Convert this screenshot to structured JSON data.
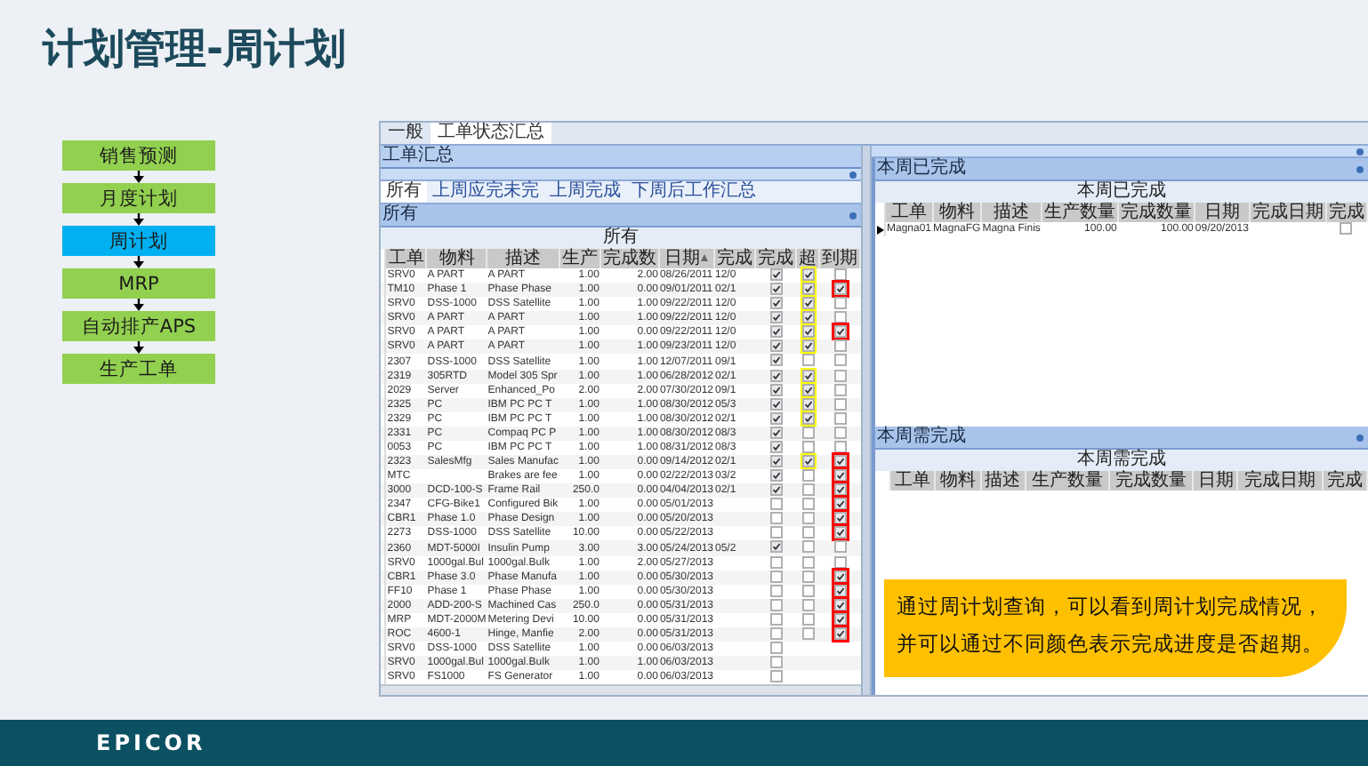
{
  "title": "计划管理-周计划",
  "flow": [
    {
      "label": "销售预测",
      "selected": false
    },
    {
      "label": "月度计划",
      "selected": false
    },
    {
      "label": "周计划",
      "selected": true
    },
    {
      "label": "MRP",
      "selected": false
    },
    {
      "label": "自动排产APS",
      "selected": false
    },
    {
      "label": "生产工单",
      "selected": false
    }
  ],
  "app": {
    "tabs": [
      {
        "label": "一般",
        "selected": false
      },
      {
        "label": "工单状态汇总",
        "selected": true
      }
    ],
    "section_title": "工单汇总",
    "subtabs": [
      {
        "label": "所有",
        "selected": true
      },
      {
        "label": "上周应完未完",
        "selected": false
      },
      {
        "label": "上周完成",
        "selected": false
      },
      {
        "label": "下周后工作汇总",
        "selected": false
      }
    ],
    "panel_title": "所有",
    "table": {
      "title": "所有",
      "columns": [
        "工单",
        "物料",
        "描述",
        "生产",
        "完成数",
        "日期",
        "完成",
        "完成",
        "超",
        "到期"
      ],
      "rows": [
        {
          "cells": [
            "SRV0",
            "A PART",
            "A PART",
            "1.00",
            "2.00",
            "08/26/2011",
            "12/0"
          ],
          "done": true,
          "over": true,
          "due": false
        },
        {
          "cells": [
            "TM10",
            "Phase 1",
            "Phase Phase",
            "1.00",
            "0.00",
            "09/01/2011",
            "02/1"
          ],
          "done": true,
          "over": true,
          "due": true
        },
        {
          "cells": [
            "SRV0",
            "DSS-1000",
            "DSS Satellite",
            "1.00",
            "1.00",
            "09/22/2011",
            "12/0"
          ],
          "done": true,
          "over": true,
          "due": false
        },
        {
          "cells": [
            "SRV0",
            "A PART",
            "A PART",
            "1.00",
            "1.00",
            "09/22/2011",
            "12/0"
          ],
          "done": true,
          "over": true,
          "due": false
        },
        {
          "cells": [
            "SRV0",
            "A PART",
            "A PART",
            "1.00",
            "0.00",
            "09/22/2011",
            "12/0"
          ],
          "done": true,
          "over": true,
          "due": true
        },
        {
          "cells": [
            "SRV0",
            "A PART",
            "A PART",
            "1.00",
            "1.00",
            "09/23/2011",
            "12/0"
          ],
          "done": true,
          "over": true,
          "due": false
        },
        {
          "cells": [
            "2307",
            "DSS-1000",
            "DSS Satellite",
            "1.00",
            "1.00",
            "12/07/2011",
            "09/1"
          ],
          "done": true,
          "over": false,
          "due": false
        },
        {
          "cells": [
            "2319",
            "305RTD",
            "Model 305 Spr",
            "1.00",
            "1.00",
            "06/28/2012",
            "02/1"
          ],
          "done": true,
          "over": true,
          "due": false
        },
        {
          "cells": [
            "2029",
            "Server",
            "Enhanced_Po",
            "2.00",
            "2.00",
            "07/30/2012",
            "09/1"
          ],
          "done": true,
          "over": true,
          "due": false
        },
        {
          "cells": [
            "2325",
            "PC",
            "IBM PC  PC T",
            "1.00",
            "1.00",
            "08/30/2012",
            "05/3"
          ],
          "done": true,
          "over": true,
          "due": false
        },
        {
          "cells": [
            "2329",
            "PC",
            "IBM PC  PC T",
            "1.00",
            "1.00",
            "08/30/2012",
            "02/1"
          ],
          "done": true,
          "over": true,
          "due": false
        },
        {
          "cells": [
            "2331",
            "PC",
            "Compaq PC  P",
            "1.00",
            "1.00",
            "08/30/2012",
            "08/3"
          ],
          "done": true,
          "over": false,
          "due": false
        },
        {
          "cells": [
            "0053",
            "PC",
            "IBM PC  PC T",
            "1.00",
            "1.00",
            "08/31/2012",
            "08/3"
          ],
          "done": true,
          "over": false,
          "due": false
        },
        {
          "cells": [
            "2323",
            "SalesMfg",
            "Sales Manufac",
            "1.00",
            "0.00",
            "09/14/2012",
            "02/1"
          ],
          "done": true,
          "over": true,
          "due": true
        },
        {
          "cells": [
            "MTC",
            "",
            "Brakes are fee",
            "1.00",
            "0.00",
            "02/22/2013",
            "03/2"
          ],
          "done": true,
          "over": false,
          "due": true
        },
        {
          "cells": [
            "3000",
            "DCD-100-S",
            "Frame Rail",
            "250.0",
            "0.00",
            "04/04/2013",
            "02/1"
          ],
          "done": true,
          "over": false,
          "due": true
        },
        {
          "cells": [
            "2347",
            "CFG-Bike1",
            "Configured Bik",
            "1.00",
            "0.00",
            "05/01/2013",
            ""
          ],
          "done": false,
          "over": false,
          "due": true
        },
        {
          "cells": [
            "CBR1",
            "Phase 1.0",
            "Phase Design",
            "1.00",
            "0.00",
            "05/20/2013",
            ""
          ],
          "done": false,
          "over": false,
          "due": true
        },
        {
          "cells": [
            "2273",
            "DSS-1000",
            "DSS Satellite",
            "10.00",
            "0.00",
            "05/22/2013",
            ""
          ],
          "done": false,
          "over": false,
          "due": true
        },
        {
          "cells": [
            "2360",
            "MDT-5000I",
            "Insulin Pump",
            "3.00",
            "3.00",
            "05/24/2013",
            "05/2"
          ],
          "done": true,
          "over": false,
          "due": false
        },
        {
          "cells": [
            "SRV0",
            "1000gal.Bul",
            "1000gal.Bulk",
            "1.00",
            "2.00",
            "05/27/2013",
            ""
          ],
          "done": false,
          "over": false,
          "due": false
        },
        {
          "cells": [
            "CBR1",
            "Phase 3.0",
            "Phase Manufa",
            "1.00",
            "0.00",
            "05/30/2013",
            ""
          ],
          "done": false,
          "over": false,
          "due": true
        },
        {
          "cells": [
            "FF10",
            "Phase 1",
            "Phase Phase",
            "1.00",
            "0.00",
            "05/30/2013",
            ""
          ],
          "done": false,
          "over": false,
          "due": true
        },
        {
          "cells": [
            "2000",
            "ADD-200-S",
            "Machined Cas",
            "250.0",
            "0.00",
            "05/31/2013",
            ""
          ],
          "done": false,
          "over": false,
          "due": true
        },
        {
          "cells": [
            "MRP",
            "MDT-2000M",
            "Metering Devi",
            "10.00",
            "0.00",
            "05/31/2013",
            ""
          ],
          "done": false,
          "over": false,
          "due": true
        },
        {
          "cells": [
            "ROC",
            "4600-1",
            "Hinge, Manfie",
            "2.00",
            "0.00",
            "05/31/2013",
            ""
          ],
          "done": false,
          "over": false,
          "due": true
        },
        {
          "cells": [
            "SRV0",
            "DSS-1000",
            "DSS Satellite",
            "1.00",
            "0.00",
            "06/03/2013",
            ""
          ],
          "done": false
        },
        {
          "cells": [
            "SRV0",
            "1000gal.Bul",
            "1000gal.Bulk",
            "1.00",
            "1.00",
            "06/03/2013",
            ""
          ],
          "done": false
        },
        {
          "cells": [
            "SRV0",
            "FS1000",
            "FS Generator",
            "1.00",
            "0.00",
            "06/03/2013",
            ""
          ],
          "done": false
        }
      ]
    },
    "right_panels": [
      {
        "title": "本周已完成",
        "table": {
          "title": "本周已完成",
          "columns": [
            "工单",
            "物料",
            "描述",
            "生产数量",
            "完成数量",
            "日期",
            "完成日期",
            "完成"
          ],
          "rows": [
            {
              "cells": [
                "Magna01",
                "MagnaFG",
                "Magna Finis",
                "100.00",
                "100.00",
                "09/20/2013",
                ""
              ],
              "done": false
            }
          ]
        }
      },
      {
        "title": "本周需完成",
        "table": {
          "title": "本周需完成",
          "columns": [
            "工单",
            "物料",
            "描述",
            "生产数量",
            "完成数量",
            "日期",
            "完成日期",
            "完成"
          ]
        }
      }
    ]
  },
  "callout": "通过周计划查询，可以看到周计划完成情况，并可以通过不同颜色表示完成进度是否超期。",
  "footer": {
    "logo": "EPICOR"
  }
}
